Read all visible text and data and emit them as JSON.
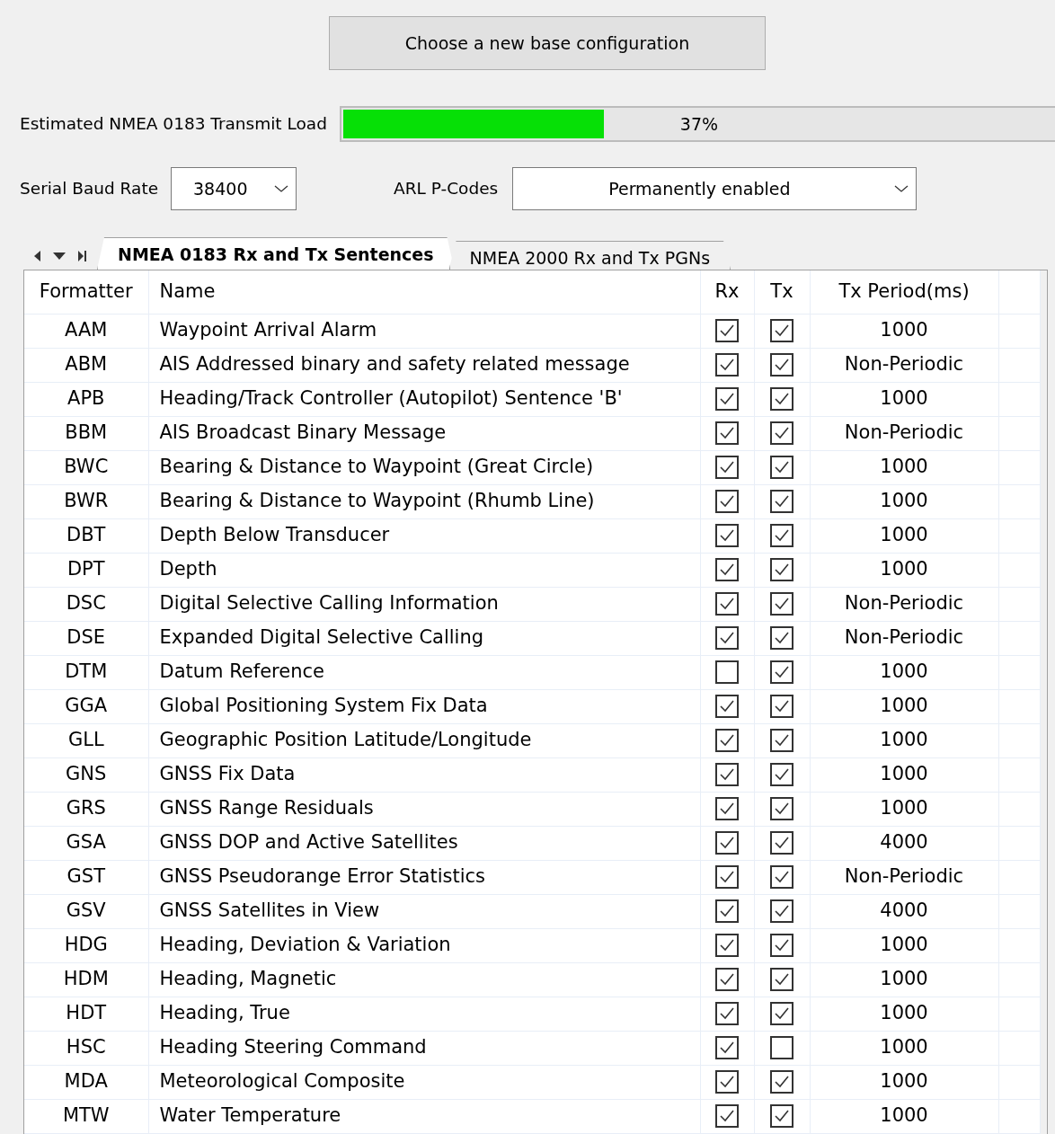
{
  "base_button": "Choose a new base configuration",
  "transmit_load": {
    "label": "Estimated NMEA 0183 Transmit Load",
    "level": 0.37,
    "reading": "37%"
  },
  "baud_rate": {
    "label": "Serial Baud Rate",
    "value": "38400"
  },
  "p_codes": {
    "label": "ARL P-Codes",
    "value": "Permanently enabled"
  },
  "tabs": [
    {
      "label": "NMEA 0183 Rx and Tx Sentences",
      "selected": true
    },
    {
      "label": "NMEA 2000 Rx and Tx PGNs",
      "selected": false
    }
  ],
  "table": {
    "columns": [
      "Formatter",
      "Name",
      "Rx",
      "Tx",
      "Tx Period(ms)"
    ],
    "rows": [
      {
        "formatter": "AAM",
        "name": "Waypoint Arrival Alarm",
        "rx": true,
        "tx": true,
        "period": "1000"
      },
      {
        "formatter": "ABM",
        "name": "AIS Addressed binary and safety related message",
        "rx": true,
        "tx": true,
        "period": "Non-Periodic"
      },
      {
        "formatter": "APB",
        "name": "Heading/Track Controller (Autopilot) Sentence 'B'",
        "rx": true,
        "tx": true,
        "period": "1000"
      },
      {
        "formatter": "BBM",
        "name": "AIS Broadcast Binary Message",
        "rx": true,
        "tx": true,
        "period": "Non-Periodic"
      },
      {
        "formatter": "BWC",
        "name": "Bearing & Distance to Waypoint (Great Circle)",
        "rx": true,
        "tx": true,
        "period": "1000"
      },
      {
        "formatter": "BWR",
        "name": "Bearing & Distance to Waypoint (Rhumb Line)",
        "rx": true,
        "tx": true,
        "period": "1000"
      },
      {
        "formatter": "DBT",
        "name": "Depth Below Transducer",
        "rx": true,
        "tx": true,
        "period": "1000"
      },
      {
        "formatter": "DPT",
        "name": "Depth",
        "rx": true,
        "tx": true,
        "period": "1000"
      },
      {
        "formatter": "DSC",
        "name": "Digital Selective Calling Information",
        "rx": true,
        "tx": true,
        "period": "Non-Periodic"
      },
      {
        "formatter": "DSE",
        "name": "Expanded Digital Selective Calling",
        "rx": true,
        "tx": true,
        "period": "Non-Periodic"
      },
      {
        "formatter": "DTM",
        "name": "Datum Reference",
        "rx": false,
        "tx": true,
        "period": "1000"
      },
      {
        "formatter": "GGA",
        "name": "Global Positioning System Fix Data",
        "rx": true,
        "tx": true,
        "period": "1000"
      },
      {
        "formatter": "GLL",
        "name": "Geographic Position Latitude/Longitude",
        "rx": true,
        "tx": true,
        "period": "1000"
      },
      {
        "formatter": "GNS",
        "name": "GNSS Fix Data",
        "rx": true,
        "tx": true,
        "period": "1000"
      },
      {
        "formatter": "GRS",
        "name": "GNSS Range Residuals",
        "rx": true,
        "tx": true,
        "period": "1000"
      },
      {
        "formatter": "GSA",
        "name": "GNSS DOP and Active Satellites",
        "rx": true,
        "tx": true,
        "period": "4000"
      },
      {
        "formatter": "GST",
        "name": "GNSS Pseudorange Error Statistics",
        "rx": true,
        "tx": true,
        "period": "Non-Periodic"
      },
      {
        "formatter": "GSV",
        "name": "GNSS Satellites in View",
        "rx": true,
        "tx": true,
        "period": "4000"
      },
      {
        "formatter": "HDG",
        "name": "Heading, Deviation & Variation",
        "rx": true,
        "tx": true,
        "period": "1000"
      },
      {
        "formatter": "HDM",
        "name": "Heading, Magnetic",
        "rx": true,
        "tx": true,
        "period": "1000"
      },
      {
        "formatter": "HDT",
        "name": "Heading, True",
        "rx": true,
        "tx": true,
        "period": "1000"
      },
      {
        "formatter": "HSC",
        "name": "Heading Steering Command",
        "rx": true,
        "tx": false,
        "period": "1000"
      },
      {
        "formatter": "MDA",
        "name": "Meteorological Composite",
        "rx": true,
        "tx": true,
        "period": "1000"
      },
      {
        "formatter": "MTW",
        "name": "Water Temperature",
        "rx": true,
        "tx": true,
        "period": "1000"
      }
    ]
  }
}
